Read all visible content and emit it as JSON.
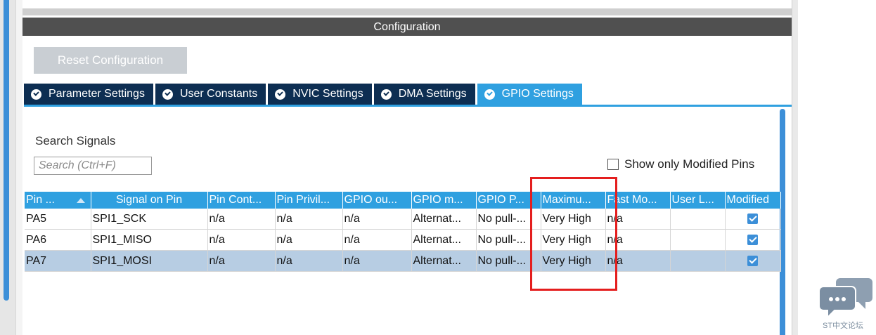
{
  "config": {
    "header": "Configuration",
    "reset_button": "Reset Configuration"
  },
  "tabs": [
    {
      "label": "Parameter Settings",
      "active": false
    },
    {
      "label": "User Constants",
      "active": false
    },
    {
      "label": "NVIC Settings",
      "active": false
    },
    {
      "label": "DMA Settings",
      "active": false
    },
    {
      "label": "GPIO Settings",
      "active": true
    }
  ],
  "search": {
    "label": "Search Signals",
    "placeholder": "Search (Ctrl+F)"
  },
  "show_modified": {
    "label": "Show only Modified Pins",
    "checked": false
  },
  "table": {
    "columns": [
      "Pin ...",
      "Signal on Pin",
      "Pin Cont...",
      "Pin Privil...",
      "GPIO ou...",
      "GPIO m...",
      "GPIO P...",
      "Maximu...",
      "Fast Mo...",
      "User L...",
      "Modified"
    ],
    "rows": [
      {
        "cells": [
          "PA5",
          "SPI1_SCK",
          "n/a",
          "n/a",
          "n/a",
          "Alternat...",
          "No pull-...",
          "Very High",
          "n/a",
          ""
        ],
        "modified": true,
        "selected": false
      },
      {
        "cells": [
          "PA6",
          "SPI1_MISO",
          "n/a",
          "n/a",
          "n/a",
          "Alternat...",
          "No pull-...",
          "Very High",
          "n/a",
          ""
        ],
        "modified": true,
        "selected": false
      },
      {
        "cells": [
          "PA7",
          "SPI1_MOSI",
          "n/a",
          "n/a",
          "n/a",
          "Alternat...",
          "No pull-...",
          "Very High",
          "n/a",
          ""
        ],
        "modified": true,
        "selected": true
      }
    ]
  },
  "watermark": {
    "text": "ST中文论坛",
    "icon": "chat-bubble-icon"
  },
  "colors": {
    "accent": "#2fa0e0",
    "tab_dark": "#0d2e52",
    "highlight": "#e41e1e",
    "header": "#505050"
  }
}
